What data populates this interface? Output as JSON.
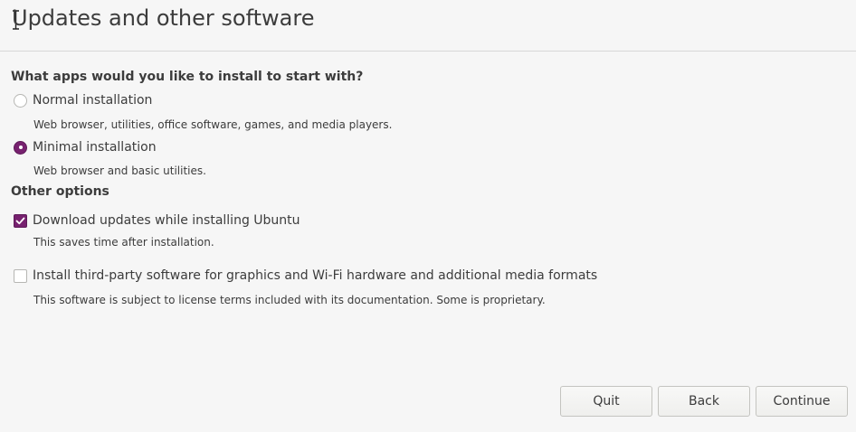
{
  "header": {
    "title": "Updates and other software"
  },
  "install_type": {
    "question": "What apps would you like to install to start with?",
    "options": [
      {
        "label": "Normal installation",
        "description": "Web browser, utilities, office software, games, and media players.",
        "selected": false
      },
      {
        "label": "Minimal installation",
        "description": "Web browser and basic utilities.",
        "selected": true
      }
    ]
  },
  "other_options": {
    "heading": "Other options",
    "items": [
      {
        "label": "Download updates while installing Ubuntu",
        "description": "This saves time after installation.",
        "checked": true
      },
      {
        "label": "Install third-party software for graphics and Wi-Fi hardware and additional media formats",
        "description": "This software is subject to license terms included with its documentation. Some is proprietary.",
        "checked": false
      }
    ]
  },
  "buttons": {
    "quit": "Quit",
    "back": "Back",
    "continue": "Continue"
  },
  "colors": {
    "accent": "#77216f",
    "background": "#f6f6f6",
    "text": "#3c3c3c"
  }
}
